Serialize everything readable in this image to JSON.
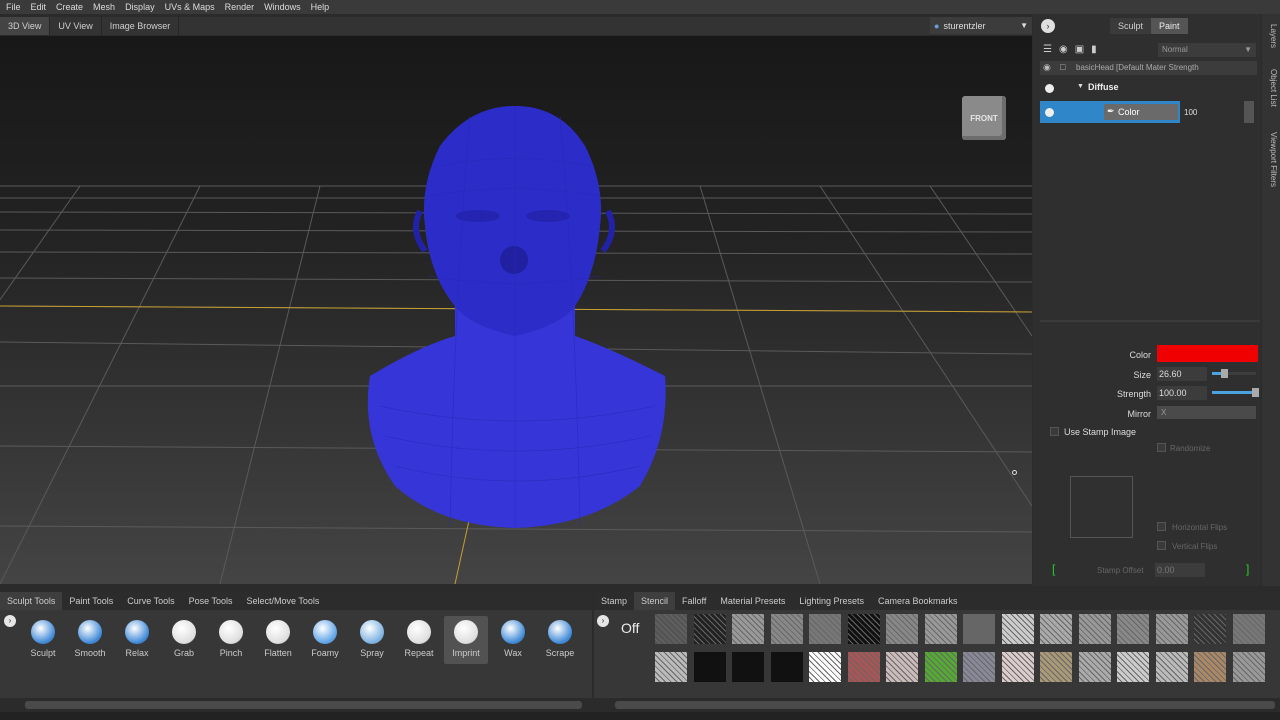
{
  "menu": [
    "File",
    "Edit",
    "Create",
    "Mesh",
    "Display",
    "UVs & Maps",
    "Render",
    "Windows",
    "Help"
  ],
  "view_tabs": [
    "3D View",
    "UV View",
    "Image Browser"
  ],
  "user": "sturentzler",
  "viewport": {
    "nav_cube_label": "FRONT"
  },
  "side_tabs": [
    "Layers",
    "Object List",
    "Viewport Filters"
  ],
  "mode_toggle": {
    "sculpt": "Sculpt",
    "paint": "Paint"
  },
  "layers": {
    "blend_mode": "Normal",
    "object_row": "basicHead [Default Mater Strength",
    "channel_group": "Diffuse",
    "channel_layer": "Color",
    "channel_value": "100"
  },
  "brush": {
    "color_label": "Color",
    "color_value": "#f00000",
    "size_label": "Size",
    "size_value": "26.60",
    "size_fraction": 0.3,
    "strength_label": "Strength",
    "strength_value": "100.00",
    "strength_fraction": 1.0,
    "mirror_label": "Mirror",
    "mirror_value": "X",
    "use_stamp_label": "Use Stamp Image",
    "randomize_label": "Randomize",
    "hflips_label": "Horizontal Flips",
    "vflips_label": "Vertical Flips",
    "stamp_offset_label": "Stamp Offset",
    "stamp_offset_value": "0.00"
  },
  "tool_tabs": [
    "Sculpt Tools",
    "Paint Tools",
    "Curve Tools",
    "Pose Tools",
    "Select/Move Tools"
  ],
  "tools": [
    "Sculpt",
    "Smooth",
    "Relax",
    "Grab",
    "Pinch",
    "Flatten",
    "Foamy",
    "Spray",
    "Repeat",
    "Imprint",
    "Wax",
    "Scrape"
  ],
  "stamp_tabs": [
    "Stamp",
    "Stencil",
    "Falloff",
    "Material Presets",
    "Lighting Presets",
    "Camera Bookmarks"
  ],
  "stencil_off": "Off"
}
